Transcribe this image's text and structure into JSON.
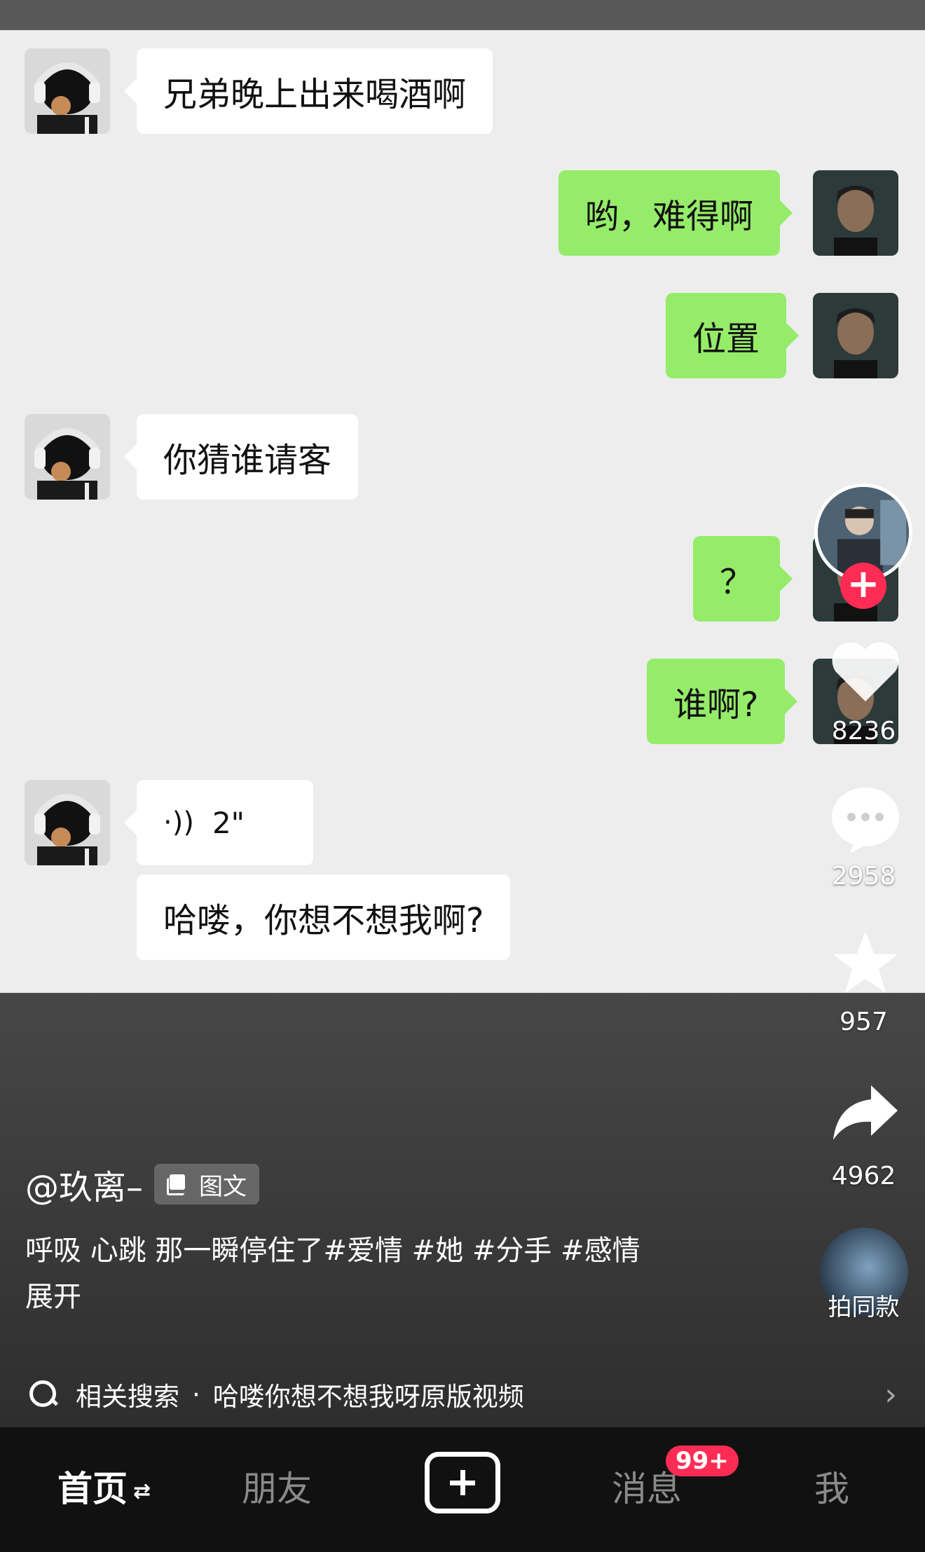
{
  "chat": {
    "messages": [
      {
        "side": "left",
        "text": "兄弟晚上出来喝酒啊"
      },
      {
        "side": "right",
        "text": "哟，难得啊"
      },
      {
        "side": "right",
        "text": "位置"
      },
      {
        "side": "left",
        "text": "你猜谁请客"
      },
      {
        "side": "right",
        "text": "？"
      },
      {
        "side": "right",
        "text": "谁啊?"
      },
      {
        "side": "left",
        "type": "voice",
        "text": "2\""
      },
      {
        "side": "left",
        "text": "哈喽，你想不想我啊?"
      }
    ]
  },
  "sidebar": {
    "likes": "8236",
    "comments": "2958",
    "favorites": "957",
    "shares": "4962",
    "same_style_label": "拍同款"
  },
  "post": {
    "author": "@玖离–",
    "content_type": "图文",
    "caption": "呼吸 心跳 那一瞬停住了",
    "hashtags": [
      "#爱情",
      "#她",
      "#分手",
      "#感情"
    ],
    "expand_label": "展开"
  },
  "related_search": {
    "label": "相关搜索",
    "separator": "·",
    "query": "哈喽你想不想我呀原版视频"
  },
  "tabbar": {
    "home": "首页",
    "home_swap_icon": "⇄",
    "friends": "朋友",
    "messages": "消息",
    "messages_badge": "99+",
    "me": "我"
  },
  "colors": {
    "chat_bg": "#ededed",
    "bubble_right": "#95ec69",
    "bubble_left": "#ffffff",
    "accent": "#fe2c55"
  }
}
